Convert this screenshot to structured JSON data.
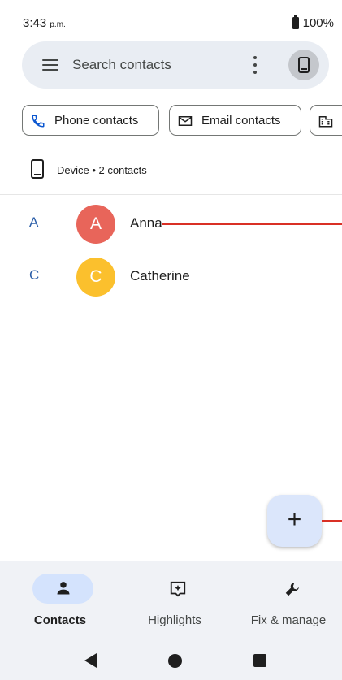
{
  "status_bar": {
    "time": "3:43",
    "time_suffix": "p.m.",
    "battery": "100%"
  },
  "search": {
    "placeholder": "Search contacts",
    "menu_icon": "menu-icon",
    "more_icon": "more-vert-icon",
    "account_icon": "phone-icon"
  },
  "filters": [
    {
      "label": "Phone contacts",
      "icon": "phone-icon"
    },
    {
      "label": "Email contacts",
      "icon": "email-icon"
    },
    {
      "label": "",
      "icon": "business-icon"
    }
  ],
  "account": {
    "label": "Device • 2 contacts",
    "icon": "smartphone-icon"
  },
  "contacts": [
    {
      "letter": "A",
      "initial": "A",
      "name": "Anna",
      "color": "#e8655a"
    },
    {
      "letter": "C",
      "initial": "C",
      "name": "Catherine",
      "color": "#fbc02d"
    }
  ],
  "fab": {
    "label": "+",
    "icon": "add-icon"
  },
  "bottom_nav": [
    {
      "label": "Contacts",
      "icon": "person-icon",
      "active": true
    },
    {
      "label": "Highlights",
      "icon": "highlights-icon",
      "active": false
    },
    {
      "label": "Fix & manage",
      "icon": "wrench-icon",
      "active": false
    }
  ],
  "colors": {
    "accent": "#2b5ea8",
    "search_bg": "#e9edf3",
    "nav_bg": "#f0f2f6",
    "active_pill": "#d4e3fd",
    "fab_bg": "#dbe6fb",
    "annotation_line": "#d93025"
  }
}
